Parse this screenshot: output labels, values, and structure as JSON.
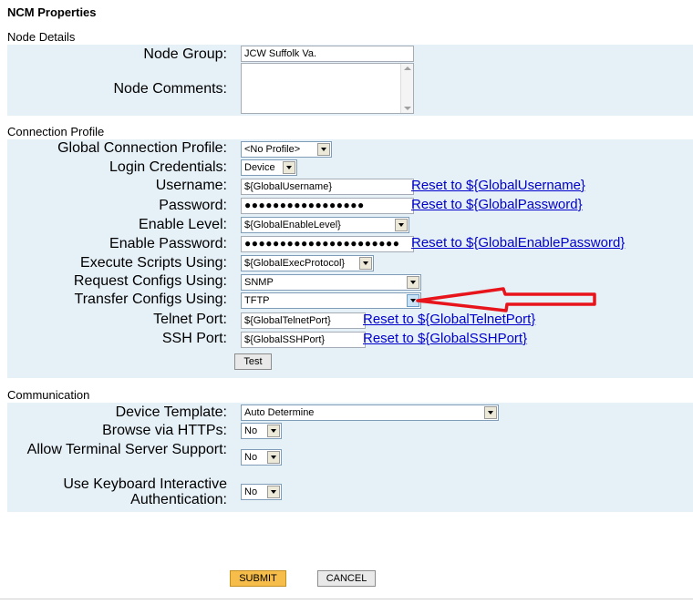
{
  "page": {
    "title": "NCM Properties"
  },
  "node_details": {
    "section_title": "Node Details",
    "node_group_label": "Node Group:",
    "node_group_value": "JCW Suffolk Va.",
    "node_comments_label": "Node Comments:",
    "node_comments_value": ""
  },
  "connection_profile": {
    "section_title": "Connection Profile",
    "global_profile_label": "Global Connection Profile:",
    "global_profile_value": "<No Profile>",
    "login_credentials_label": "Login Credentials:",
    "login_credentials_value": "Device",
    "username_label": "Username:",
    "username_value": "${GlobalUsername}",
    "username_reset": "Reset to ${GlobalUsername}",
    "password_label": "Password:",
    "password_value": "●●●●●●●●●●●●●●●●●",
    "password_reset": "Reset to ${GlobalPassword}",
    "enable_level_label": "Enable Level:",
    "enable_level_value": "${GlobalEnableLevel}",
    "enable_password_label": "Enable Password:",
    "enable_password_value": "●●●●●●●●●●●●●●●●●●●●●●",
    "enable_password_reset": "Reset to ${GlobalEnablePassword}",
    "execute_scripts_label": "Execute Scripts Using:",
    "execute_scripts_value": "${GlobalExecProtocol}",
    "request_configs_label": "Request Configs Using:",
    "request_configs_value": "SNMP",
    "transfer_configs_label": "Transfer Configs Using:",
    "transfer_configs_value": "TFTP",
    "telnet_port_label": "Telnet Port:",
    "telnet_port_value": "${GlobalTelnetPort}",
    "telnet_port_reset": "Reset to ${GlobalTelnetPort}",
    "ssh_port_label": "SSH Port:",
    "ssh_port_value": "${GlobalSSHPort}",
    "ssh_port_reset": "Reset to ${GlobalSSHPort}",
    "test_button": "Test"
  },
  "communication": {
    "section_title": "Communication",
    "device_template_label": "Device Template:",
    "device_template_value": "Auto Determine",
    "browse_https_label": "Browse via HTTPs:",
    "browse_https_value": "No",
    "terminal_server_label": "Allow Terminal Server Support:",
    "terminal_server_value": "No",
    "keyboard_auth_label": "Use Keyboard Interactive Authentication:",
    "keyboard_auth_value": "No"
  },
  "actions": {
    "submit": "SUBMIT",
    "cancel": "CANCEL"
  },
  "colors": {
    "panel_bg": "#e6f0f7",
    "link": "#0000cc",
    "submit_bg": "#f6bd4a",
    "annotation_arrow": "#e8141b"
  }
}
